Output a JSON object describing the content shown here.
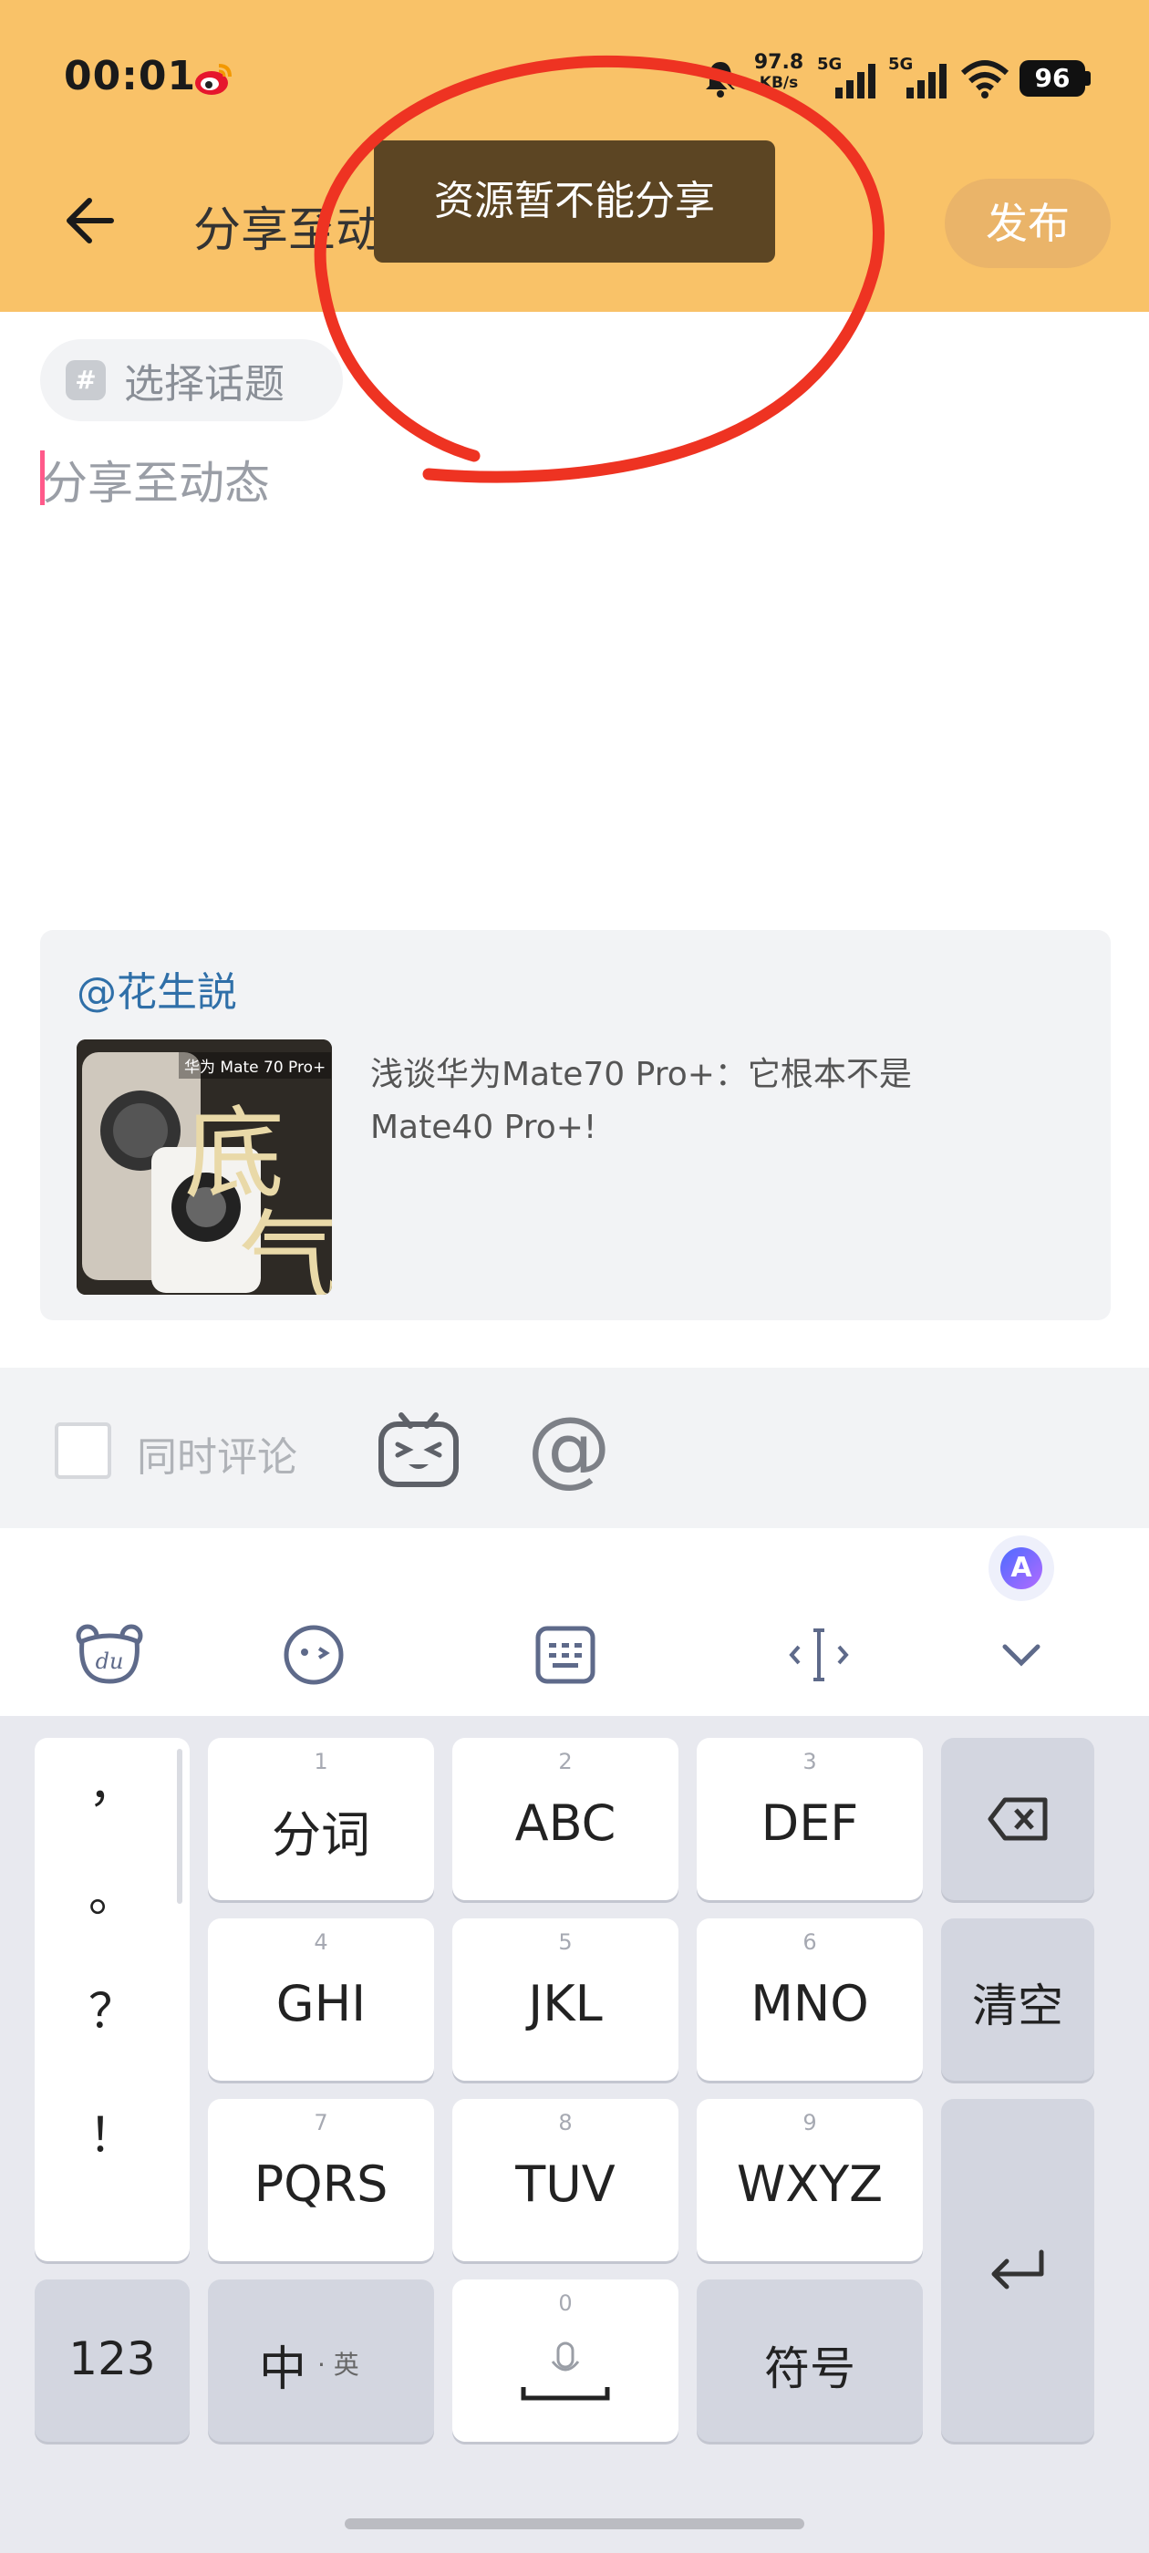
{
  "status_bar": {
    "time": "00:01",
    "net_speed_value": "97.8",
    "net_speed_unit": "KB/s",
    "signal1": "5G",
    "signal2": "5G",
    "battery": "96"
  },
  "header": {
    "title": "分享至动态",
    "publish_label": "发布"
  },
  "toast": {
    "message": "资源暂不能分享"
  },
  "compose": {
    "topic_label": "选择话题",
    "placeholder": "分享至动态"
  },
  "shared_card": {
    "author": "@花生説",
    "thumbnail_badge": "华为 Mate 70 Pro+",
    "thumbnail_big_text_1": "底",
    "thumbnail_big_text_2": "气",
    "text_line1": "浅谈华为Mate70 Pro+：它根本不是",
    "text_line2": "Mate40 Pro+!"
  },
  "actions": {
    "also_comment_label": "同时评论",
    "at_symbol": "@"
  },
  "ime_toolbar": {
    "ai_label": "A",
    "icons": [
      "du-bear-icon",
      "emoji-face-icon",
      "keyboard-icon",
      "cursor-move-icon",
      "collapse-chevron-icon"
    ]
  },
  "keyboard": {
    "punctuation": [
      "，",
      "。",
      "？",
      "！"
    ],
    "keys": [
      {
        "num": "1",
        "label": "分词"
      },
      {
        "num": "2",
        "label": "ABC"
      },
      {
        "num": "3",
        "label": "DEF"
      },
      {
        "num": "4",
        "label": "GHI"
      },
      {
        "num": "5",
        "label": "JKL"
      },
      {
        "num": "6",
        "label": "MNO"
      },
      {
        "num": "7",
        "label": "PQRS"
      },
      {
        "num": "8",
        "label": "TUV"
      },
      {
        "num": "9",
        "label": "WXYZ"
      },
      {
        "num": "0",
        "label": ""
      }
    ],
    "clear_label": "清空",
    "numbers_label": "123",
    "lang_main": "中",
    "lang_alt": "· 英",
    "symbols_label": "符号"
  },
  "colors": {
    "header_bg": "#f9c268",
    "publish_bg": "#eab469",
    "toast_bg": "#5c4523",
    "annotation": "#ee3322",
    "author_link": "#2f6fa8"
  }
}
